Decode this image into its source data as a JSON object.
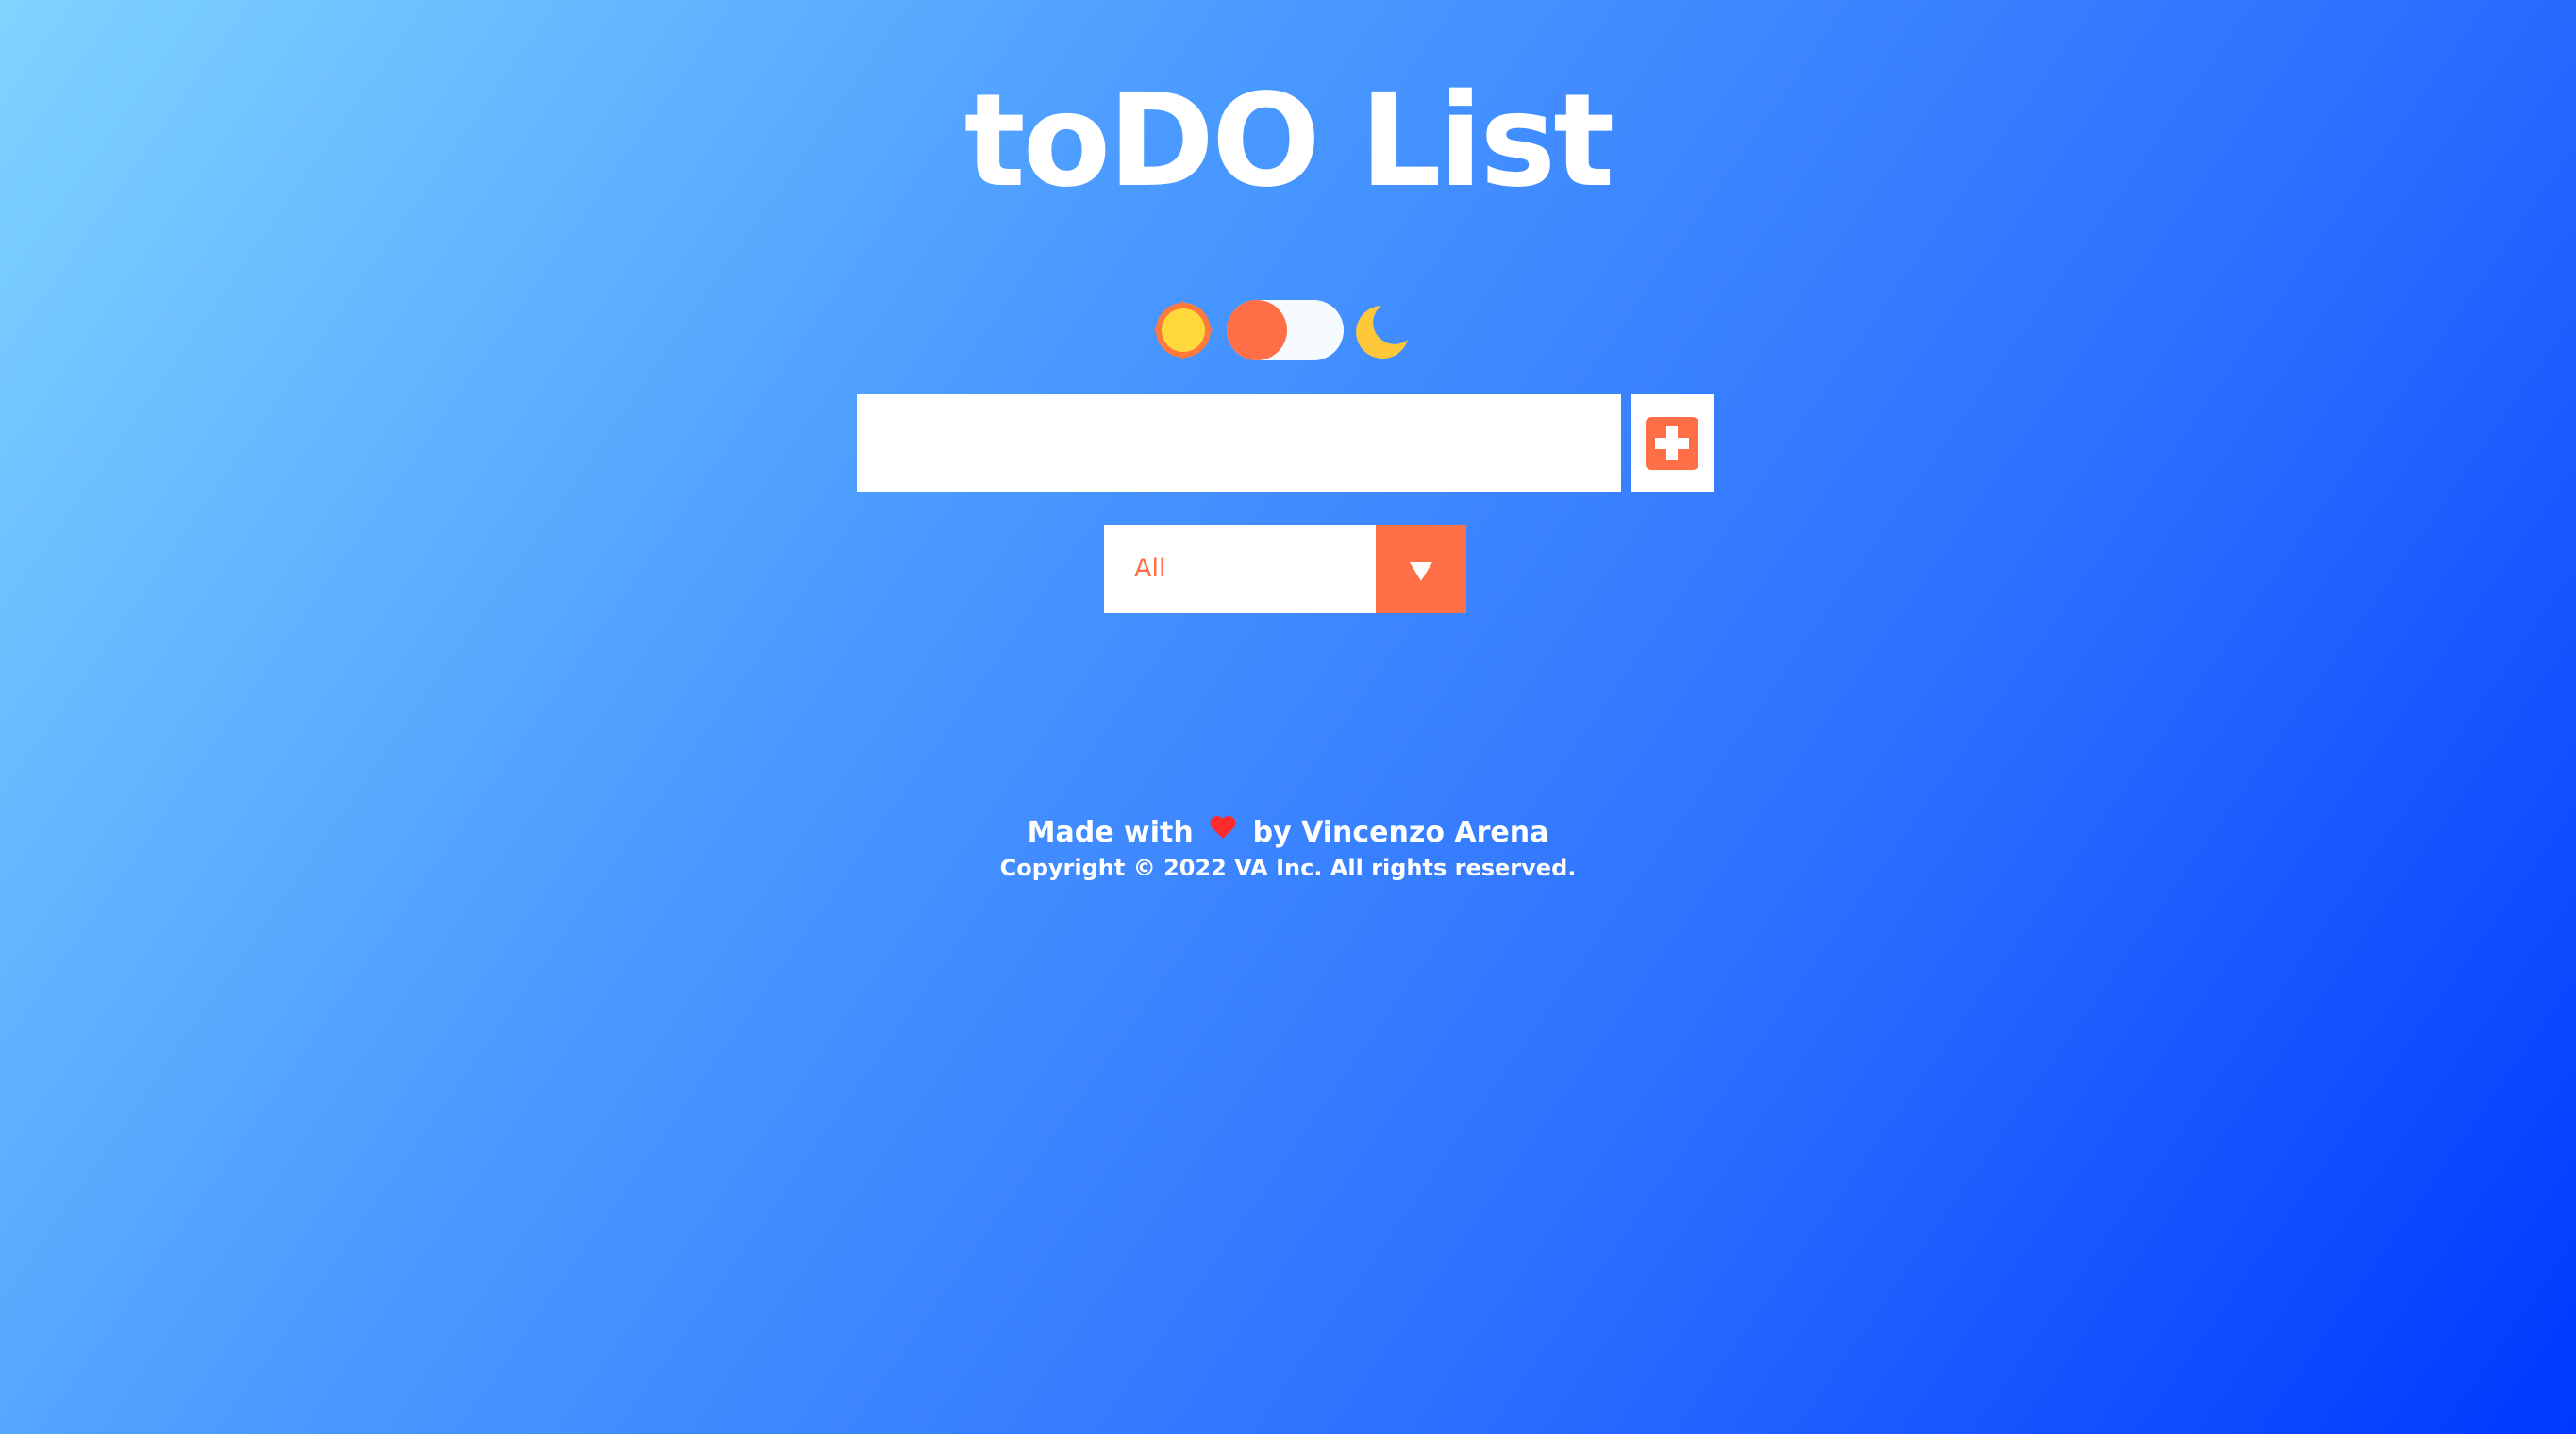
{
  "header": {
    "title": "toDO List"
  },
  "theme_switch": {
    "light_icon": "sun-icon",
    "dark_icon": "moon-icon",
    "state": "light"
  },
  "todo_form": {
    "input_value": "",
    "input_placeholder": "",
    "add_icon": "plus-square-icon"
  },
  "filter": {
    "selected": "All",
    "arrow_icon": "caret-down-icon"
  },
  "footer": {
    "made_with": "Made with",
    "heart_icon": "heart-icon",
    "by_author": "by Vincenzo Arena",
    "copyright": "Copyright © 2022 VA Inc. All rights reserved."
  },
  "colors": {
    "accent": "#ff6f47",
    "heart": "#ff2a2a",
    "sun": "#ffd93b",
    "moon": "#ffc83a",
    "gradient_start": "#7fd4ff",
    "gradient_end": "#0038ff"
  }
}
